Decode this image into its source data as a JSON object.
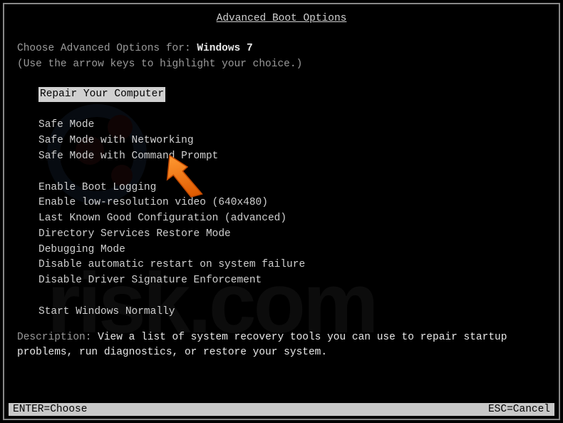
{
  "title": "Advanced Boot Options",
  "instruction_prefix": "Choose Advanced Options for: ",
  "os_name": "Windows 7",
  "instruction_sub": "(Use the arrow keys to highlight your choice.)",
  "menu": {
    "selected": "Repair Your Computer",
    "group1": [
      "Safe Mode",
      "Safe Mode with Networking",
      "Safe Mode with Command Prompt"
    ],
    "group2": [
      "Enable Boot Logging",
      "Enable low-resolution video (640x480)",
      "Last Known Good Configuration (advanced)",
      "Directory Services Restore Mode",
      "Debugging Mode",
      "Disable automatic restart on system failure",
      "Disable Driver Signature Enforcement"
    ],
    "group3": [
      "Start Windows Normally"
    ]
  },
  "description_label": "Description: ",
  "description_text": "View a list of system recovery tools you can use to repair startup problems, run diagnostics, or restore your system.",
  "footer": {
    "left": "ENTER=Choose",
    "right": "ESC=Cancel"
  },
  "watermark_text": "risk.com"
}
